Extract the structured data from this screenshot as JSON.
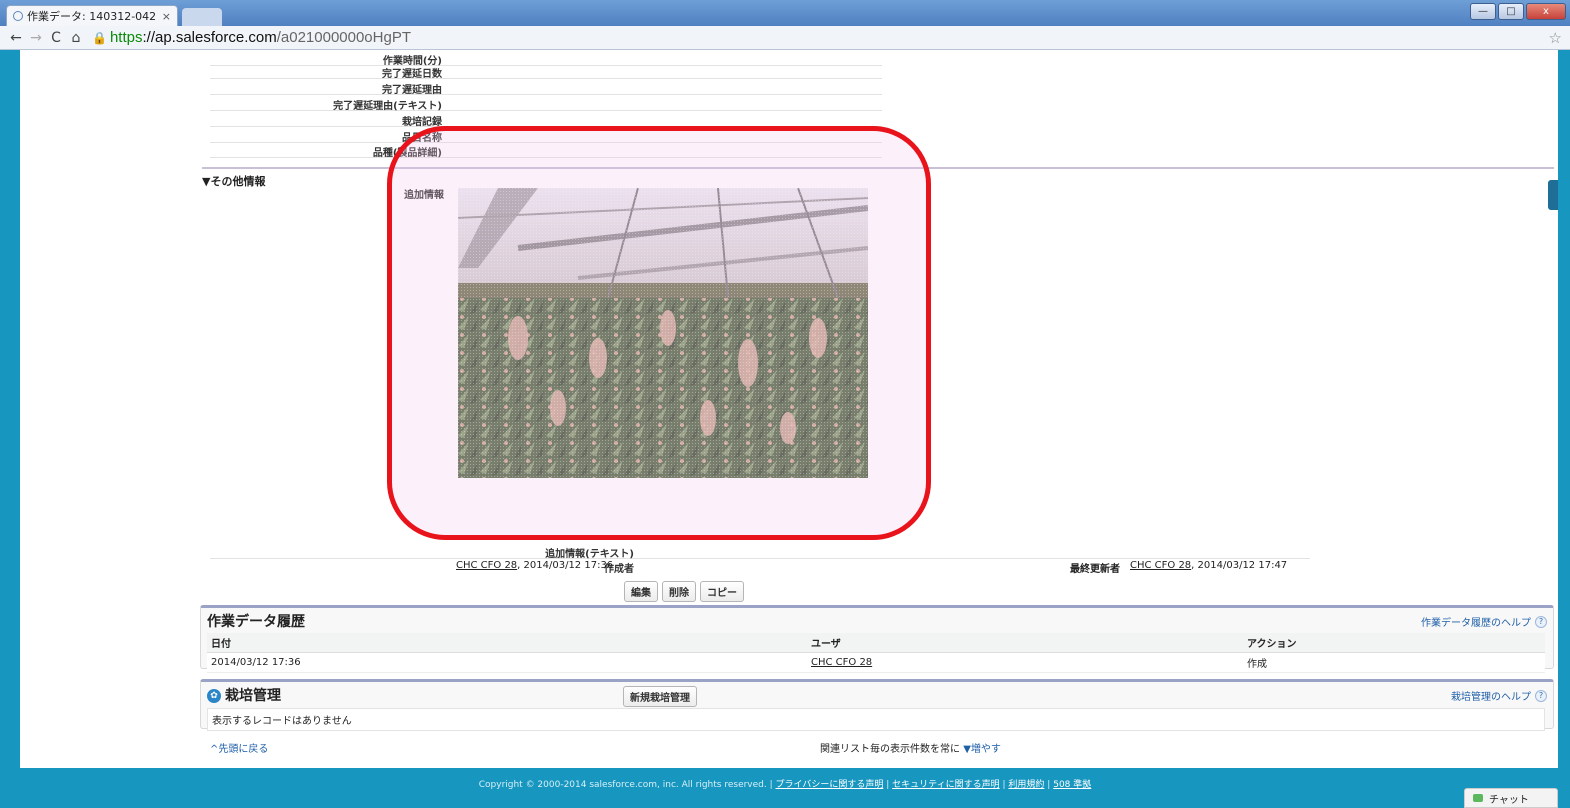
{
  "browser": {
    "tab_title": "作業データ: 140312-042",
    "tab_close": "×",
    "url_https": "https",
    "url_host": "://ap.salesforce.com",
    "url_path": "/a021000000oHgPT",
    "back": "←",
    "forward": "→",
    "reload": "C",
    "home": "⌂",
    "star": "☆",
    "win_min": "—",
    "win_max": "□",
    "win_close": "x"
  },
  "fields_top": [
    {
      "label": "作業時間(分)"
    },
    {
      "label": "完了遅延日数"
    },
    {
      "label": "完了遅延理由"
    },
    {
      "label": "完了遅延理由(テキスト)"
    },
    {
      "label": "栽培記録"
    },
    {
      "label": "品目名称"
    },
    {
      "label": "品種(製品詳細)"
    }
  ],
  "section": {
    "title": "▼その他情報",
    "additional_info_label": "追加情報",
    "additional_info_text_label": "追加情報(テキスト)"
  },
  "meta": {
    "created_by_label": "作成者",
    "created_by_user": "CHC CFO 28",
    "created_date": ", 2014/03/12 17:36",
    "modified_by_label": "最終更新者",
    "modified_by_user": "CHC CFO 28",
    "modified_date": ", 2014/03/12 17:47"
  },
  "buttons": {
    "edit": "編集",
    "delete": "削除",
    "copy": "コピー"
  },
  "history": {
    "title": "作業データ履歴",
    "help": "作業データ履歴のヘルプ",
    "columns": [
      "日付",
      "ユーザ",
      "アクション"
    ],
    "rows": [
      [
        "2014/03/12 17:36",
        "CHC CFO 28",
        "作成"
      ]
    ]
  },
  "cultivation": {
    "title": "栽培管理",
    "new_button": "新規栽培管理",
    "help": "栽培管理のヘルプ",
    "empty": "表示するレコードはありません"
  },
  "bottom": {
    "back_to_top": "^先頭に戻る",
    "show_more_prefix": "関連リスト毎の表示件数を常に",
    "show_more_link": "▼増やす"
  },
  "footer": {
    "copyright": "Copyright © 2000-2014 salesforce.com, inc. All rights reserved. |",
    "privacy": "プライバシーに関する声明",
    "security": "セキュリティに関する声明",
    "terms": "利用規約",
    "sec508": "508 準拠",
    "sep": "|"
  },
  "chat": {
    "label": "チャット"
  },
  "colors": {
    "page_bg": "#1797c0",
    "highlight": "#e8131b",
    "link": "#1f5fa8"
  }
}
